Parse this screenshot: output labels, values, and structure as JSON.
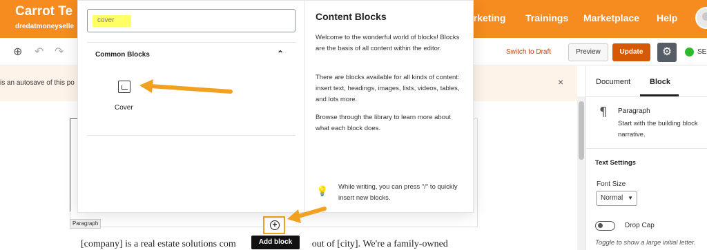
{
  "header": {
    "site_title": "Carrot Te",
    "site_subtitle": "dredatmoneyselle",
    "nav": [
      "arketing",
      "Trainings",
      "Marketplace",
      "Help"
    ]
  },
  "toolbar": {
    "switch_to_draft": "Switch to Draft",
    "preview": "Preview",
    "update": "Update",
    "seo_label": "SE"
  },
  "notice": {
    "text": "is an autosave of this po",
    "close": "×"
  },
  "editor": {
    "paragraph_tag": "Paragraph",
    "content": "[company] is a real estate solutions com",
    "content_tail": "out of [city].  We're a family-owned",
    "add_block_tooltip": "Add block"
  },
  "inserter": {
    "search_value": "cover",
    "category": "Common Blocks",
    "block_label": "Cover",
    "info_title": "Content Blocks",
    "info_p1": "Welcome to the wonderful world of blocks! Blocks are the basis of all content within the editor.",
    "info_p2": "There are blocks available for all kinds of content: insert text, headings, images, lists, videos, tables, and lots more.",
    "info_p3": "Browse through the library to learn more about what each block does.",
    "tip": "While writing, you can press \"/\" to quickly insert new blocks."
  },
  "sidebar": {
    "tabs": [
      "Document",
      "Block"
    ],
    "block_name": "Paragraph",
    "block_desc": "Start with the building block narrative.",
    "section_title": "Text Settings",
    "font_size_label": "Font Size",
    "font_size_value": "Normal",
    "drop_cap_label": "Drop Cap",
    "drop_cap_help": "Toggle to show a large initial letter."
  },
  "colors": {
    "brand_orange": "#f68b1f",
    "update_button": "#d65a05",
    "annotation_arrow": "#f2a01f",
    "search_highlight": "#ffff66"
  }
}
